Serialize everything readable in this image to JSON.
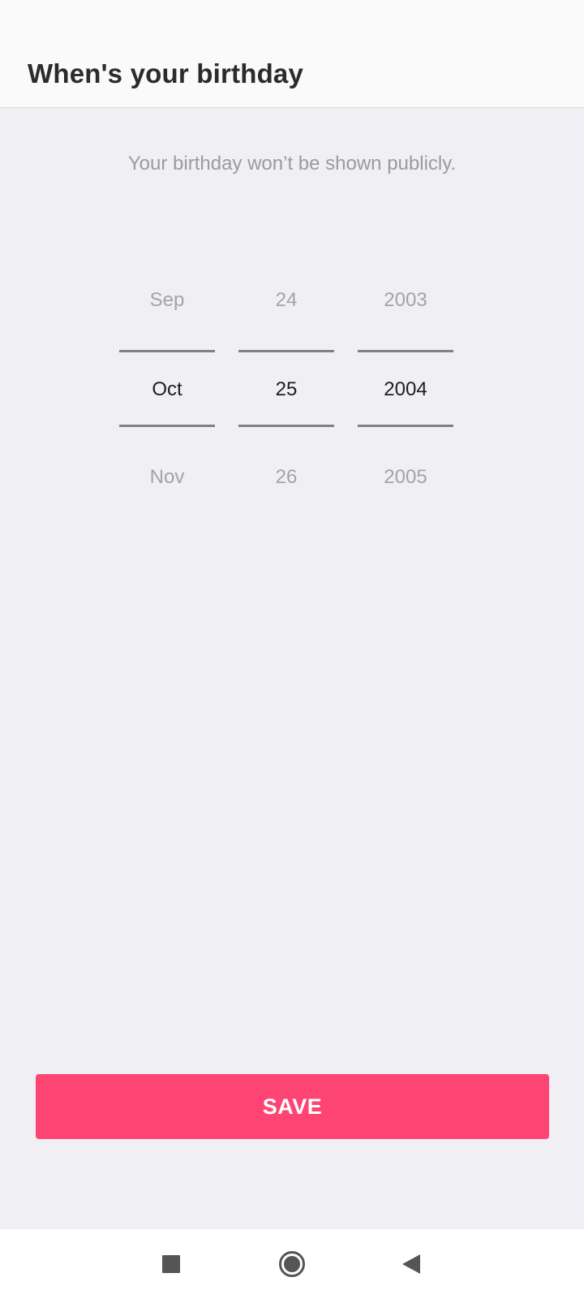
{
  "header": {
    "title": "When's your birthday"
  },
  "subtitle": "Your birthday won’t be shown publicly.",
  "picker": {
    "month": {
      "prev": "Sep",
      "selected": "Oct",
      "next": "Nov"
    },
    "day": {
      "prev": "24",
      "selected": "25",
      "next": "26"
    },
    "year": {
      "prev": "2003",
      "selected": "2004",
      "next": "2005"
    }
  },
  "save_label": "SAVE",
  "colors": {
    "accent": "#fe4473",
    "background": "#efeff4",
    "header_bg": "#fafafa"
  },
  "navbar": {
    "icons": [
      "recents-icon",
      "home-icon",
      "back-icon"
    ]
  }
}
